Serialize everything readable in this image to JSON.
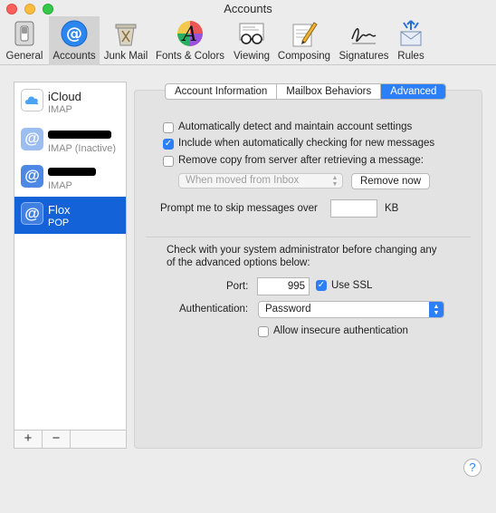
{
  "window": {
    "title": "Accounts"
  },
  "toolbar": {
    "items": [
      {
        "label": "General",
        "icon": "switch-icon"
      },
      {
        "label": "Accounts",
        "icon": "at-sign-icon"
      },
      {
        "label": "Junk Mail",
        "icon": "trash-icon"
      },
      {
        "label": "Fonts & Colors",
        "icon": "font-icon"
      },
      {
        "label": "Viewing",
        "icon": "glasses-icon"
      },
      {
        "label": "Composing",
        "icon": "pencil-icon"
      },
      {
        "label": "Signatures",
        "icon": "signature-icon"
      },
      {
        "label": "Rules",
        "icon": "rules-icon"
      }
    ],
    "selected": "Accounts"
  },
  "sidebar": {
    "accounts": [
      {
        "name": "iCloud",
        "type": "IMAP",
        "icon": "cloud-icon"
      },
      {
        "name": "",
        "type": "IMAP (Inactive)",
        "icon": "at-sign-icon",
        "name_redacted": true
      },
      {
        "name": "",
        "type": "IMAP",
        "icon": "at-sign-icon",
        "name_redacted": true
      },
      {
        "name": "Flox",
        "type": "POP",
        "icon": "at-sign-icon"
      }
    ],
    "selected": "Flox",
    "add_label": "+",
    "remove_label": "−"
  },
  "tabs": [
    {
      "label": "Account Information"
    },
    {
      "label": "Mailbox Behaviors"
    },
    {
      "label": "Advanced"
    }
  ],
  "selected_tab": "Advanced",
  "advanced": {
    "auto_detect": {
      "label": "Automatically detect and maintain account settings",
      "checked": false
    },
    "include_checking": {
      "label": "Include when automatically checking for new messages",
      "checked": true
    },
    "remove_copy": {
      "label": "Remove copy from server after retrieving a message:",
      "checked": false
    },
    "remove_when": {
      "value": "When moved from Inbox"
    },
    "remove_now_label": "Remove now",
    "prompt_label": "Prompt me to skip messages over",
    "prompt_value": "",
    "prompt_unit": "KB",
    "admin_note_line1": "Check with your system administrator before changing any",
    "admin_note_line2": "of the advanced options below:",
    "port_label": "Port:",
    "port_value": "995",
    "use_ssl": {
      "label": "Use SSL",
      "checked": true
    },
    "auth_label": "Authentication:",
    "auth_value": "Password",
    "insecure": {
      "label": "Allow insecure authentication",
      "checked": false
    }
  },
  "help_label": "?",
  "colors": {
    "accent": "#2d7ff7",
    "selection": "#1362d8"
  }
}
